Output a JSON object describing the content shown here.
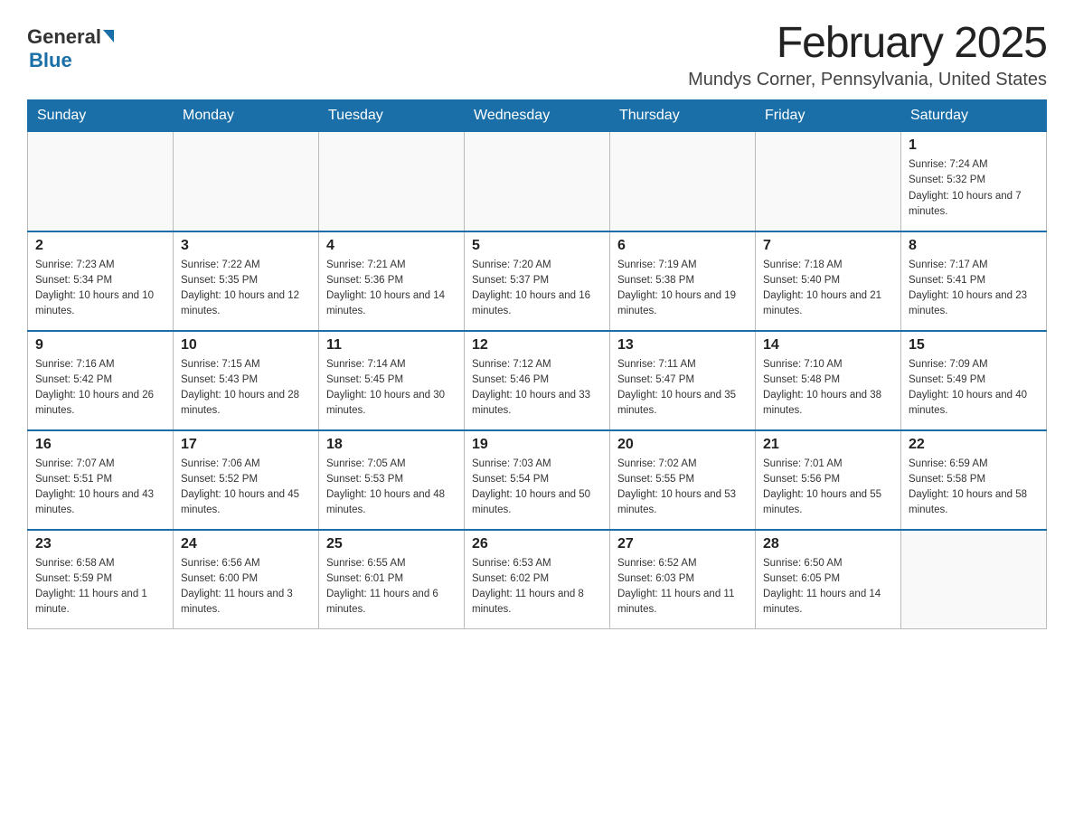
{
  "header": {
    "logo_general": "General",
    "logo_blue": "Blue",
    "month_title": "February 2025",
    "location": "Mundys Corner, Pennsylvania, United States"
  },
  "weekdays": [
    "Sunday",
    "Monday",
    "Tuesday",
    "Wednesday",
    "Thursday",
    "Friday",
    "Saturday"
  ],
  "weeks": [
    [
      {
        "day": "",
        "info": ""
      },
      {
        "day": "",
        "info": ""
      },
      {
        "day": "",
        "info": ""
      },
      {
        "day": "",
        "info": ""
      },
      {
        "day": "",
        "info": ""
      },
      {
        "day": "",
        "info": ""
      },
      {
        "day": "1",
        "info": "Sunrise: 7:24 AM\nSunset: 5:32 PM\nDaylight: 10 hours and 7 minutes."
      }
    ],
    [
      {
        "day": "2",
        "info": "Sunrise: 7:23 AM\nSunset: 5:34 PM\nDaylight: 10 hours and 10 minutes."
      },
      {
        "day": "3",
        "info": "Sunrise: 7:22 AM\nSunset: 5:35 PM\nDaylight: 10 hours and 12 minutes."
      },
      {
        "day": "4",
        "info": "Sunrise: 7:21 AM\nSunset: 5:36 PM\nDaylight: 10 hours and 14 minutes."
      },
      {
        "day": "5",
        "info": "Sunrise: 7:20 AM\nSunset: 5:37 PM\nDaylight: 10 hours and 16 minutes."
      },
      {
        "day": "6",
        "info": "Sunrise: 7:19 AM\nSunset: 5:38 PM\nDaylight: 10 hours and 19 minutes."
      },
      {
        "day": "7",
        "info": "Sunrise: 7:18 AM\nSunset: 5:40 PM\nDaylight: 10 hours and 21 minutes."
      },
      {
        "day": "8",
        "info": "Sunrise: 7:17 AM\nSunset: 5:41 PM\nDaylight: 10 hours and 23 minutes."
      }
    ],
    [
      {
        "day": "9",
        "info": "Sunrise: 7:16 AM\nSunset: 5:42 PM\nDaylight: 10 hours and 26 minutes."
      },
      {
        "day": "10",
        "info": "Sunrise: 7:15 AM\nSunset: 5:43 PM\nDaylight: 10 hours and 28 minutes."
      },
      {
        "day": "11",
        "info": "Sunrise: 7:14 AM\nSunset: 5:45 PM\nDaylight: 10 hours and 30 minutes."
      },
      {
        "day": "12",
        "info": "Sunrise: 7:12 AM\nSunset: 5:46 PM\nDaylight: 10 hours and 33 minutes."
      },
      {
        "day": "13",
        "info": "Sunrise: 7:11 AM\nSunset: 5:47 PM\nDaylight: 10 hours and 35 minutes."
      },
      {
        "day": "14",
        "info": "Sunrise: 7:10 AM\nSunset: 5:48 PM\nDaylight: 10 hours and 38 minutes."
      },
      {
        "day": "15",
        "info": "Sunrise: 7:09 AM\nSunset: 5:49 PM\nDaylight: 10 hours and 40 minutes."
      }
    ],
    [
      {
        "day": "16",
        "info": "Sunrise: 7:07 AM\nSunset: 5:51 PM\nDaylight: 10 hours and 43 minutes."
      },
      {
        "day": "17",
        "info": "Sunrise: 7:06 AM\nSunset: 5:52 PM\nDaylight: 10 hours and 45 minutes."
      },
      {
        "day": "18",
        "info": "Sunrise: 7:05 AM\nSunset: 5:53 PM\nDaylight: 10 hours and 48 minutes."
      },
      {
        "day": "19",
        "info": "Sunrise: 7:03 AM\nSunset: 5:54 PM\nDaylight: 10 hours and 50 minutes."
      },
      {
        "day": "20",
        "info": "Sunrise: 7:02 AM\nSunset: 5:55 PM\nDaylight: 10 hours and 53 minutes."
      },
      {
        "day": "21",
        "info": "Sunrise: 7:01 AM\nSunset: 5:56 PM\nDaylight: 10 hours and 55 minutes."
      },
      {
        "day": "22",
        "info": "Sunrise: 6:59 AM\nSunset: 5:58 PM\nDaylight: 10 hours and 58 minutes."
      }
    ],
    [
      {
        "day": "23",
        "info": "Sunrise: 6:58 AM\nSunset: 5:59 PM\nDaylight: 11 hours and 1 minute."
      },
      {
        "day": "24",
        "info": "Sunrise: 6:56 AM\nSunset: 6:00 PM\nDaylight: 11 hours and 3 minutes."
      },
      {
        "day": "25",
        "info": "Sunrise: 6:55 AM\nSunset: 6:01 PM\nDaylight: 11 hours and 6 minutes."
      },
      {
        "day": "26",
        "info": "Sunrise: 6:53 AM\nSunset: 6:02 PM\nDaylight: 11 hours and 8 minutes."
      },
      {
        "day": "27",
        "info": "Sunrise: 6:52 AM\nSunset: 6:03 PM\nDaylight: 11 hours and 11 minutes."
      },
      {
        "day": "28",
        "info": "Sunrise: 6:50 AM\nSunset: 6:05 PM\nDaylight: 11 hours and 14 minutes."
      },
      {
        "day": "",
        "info": ""
      }
    ]
  ]
}
